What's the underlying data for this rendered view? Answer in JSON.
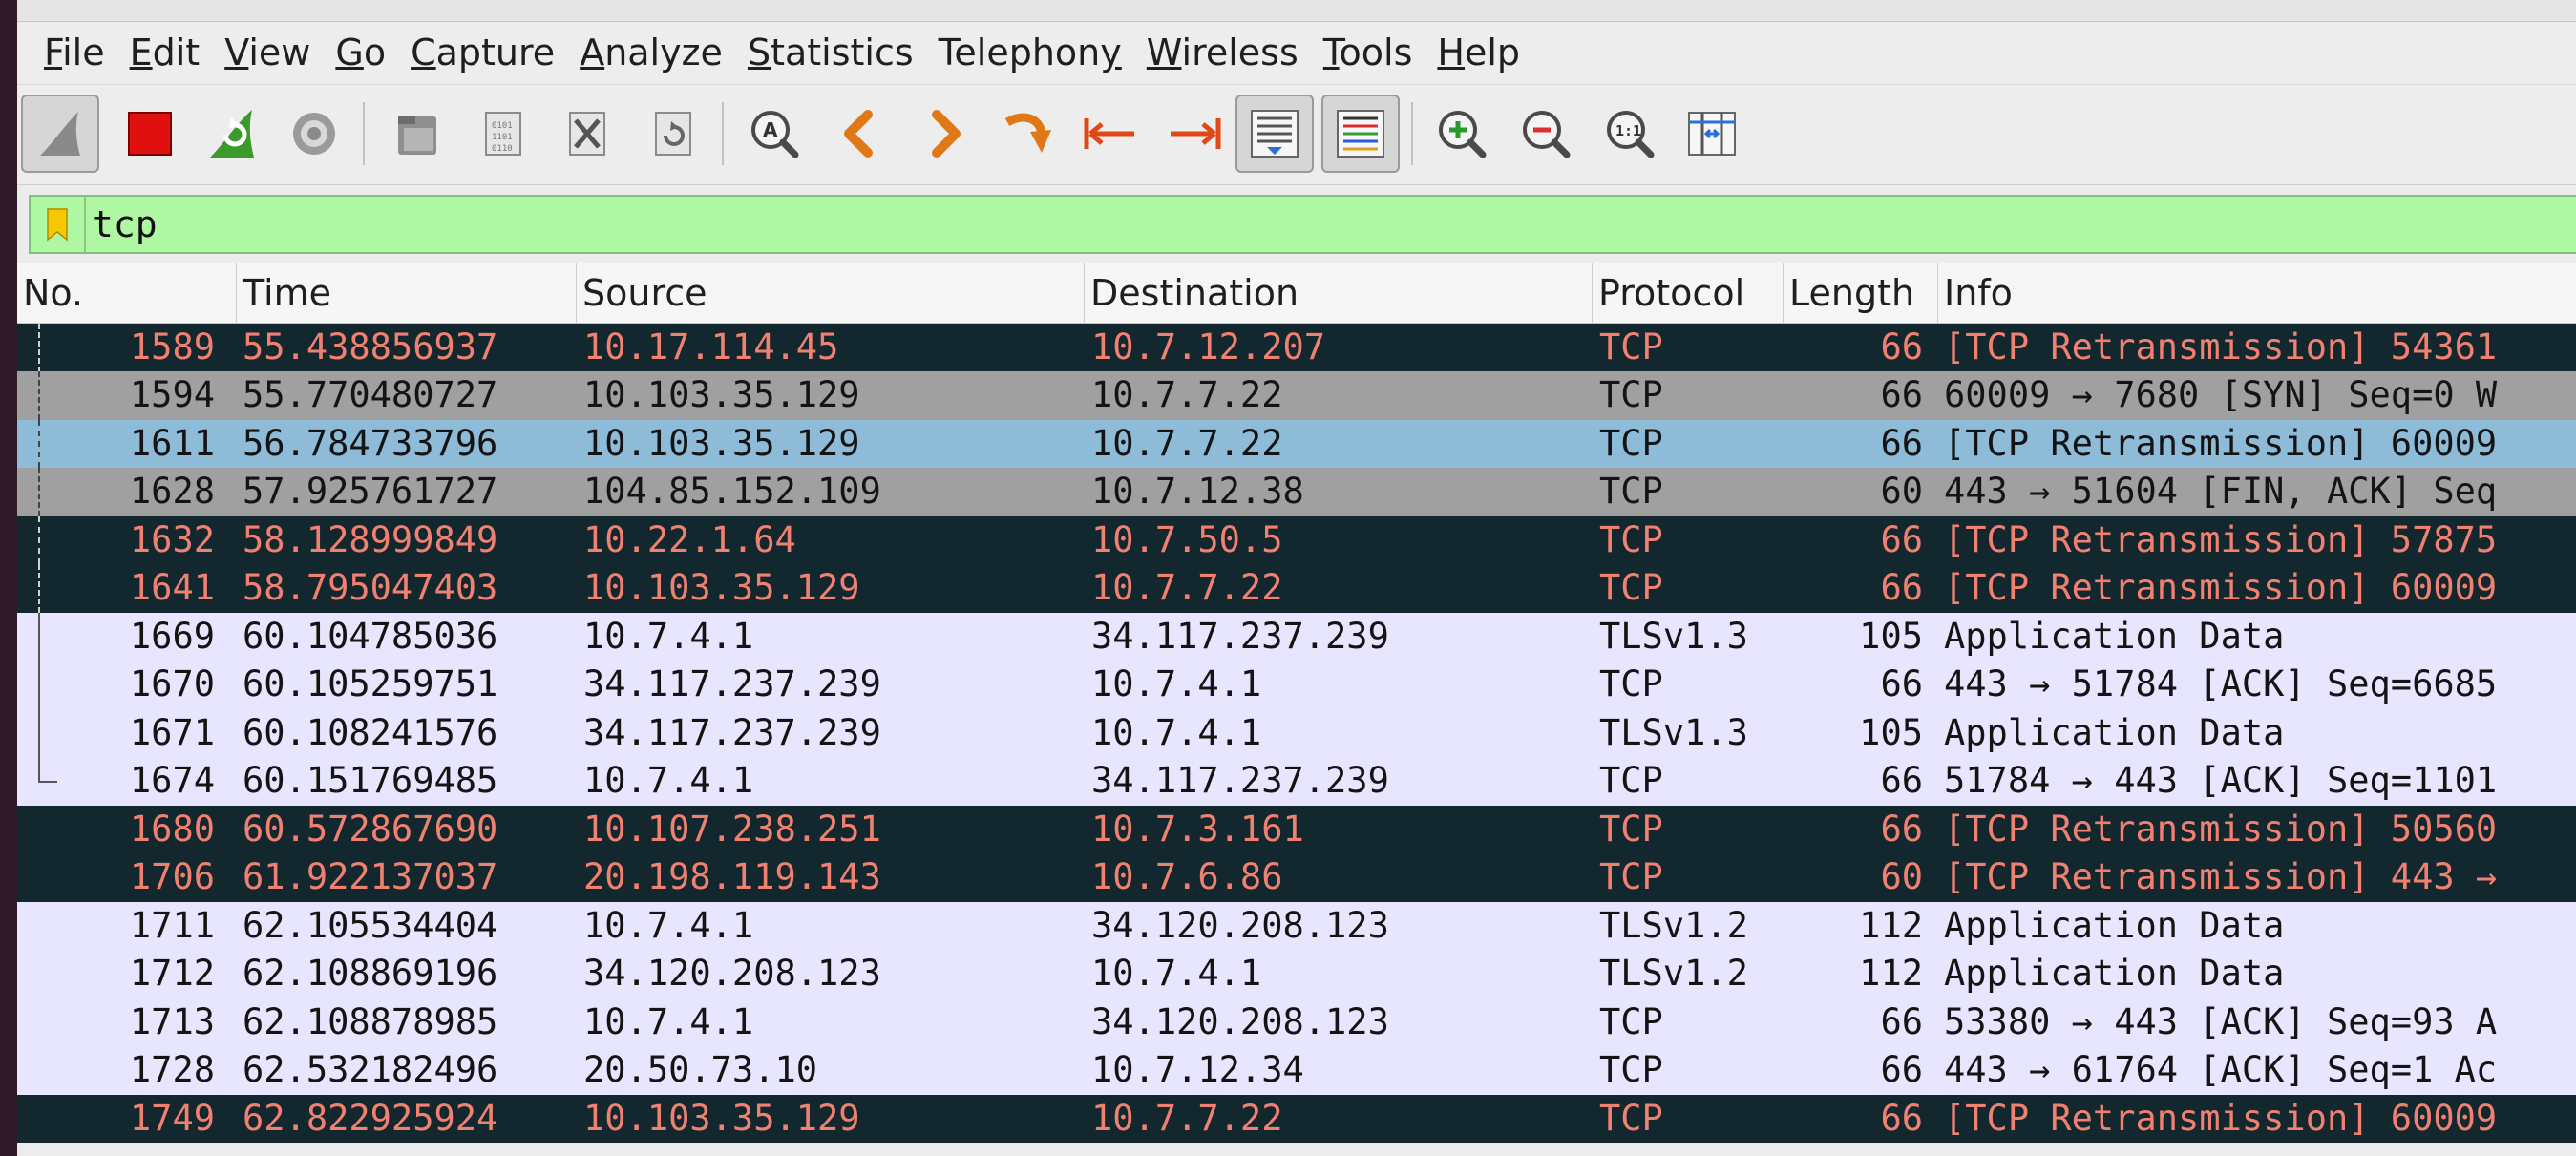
{
  "colors": {
    "row_bad_bg": "#12272e",
    "row_bad_fg": "#f08070",
    "row_gray_bg": "#a0a0a0",
    "row_gray_fg": "#141414",
    "row_selected_bg": "#8ebbd8",
    "row_selected_fg": "#141414",
    "row_normal_bg": "#e7e6fe",
    "row_normal_fg": "#141414",
    "filter_bg": "#aff7a3"
  },
  "menu": [
    {
      "pre": "",
      "mn": "F",
      "post": "ile"
    },
    {
      "pre": "",
      "mn": "E",
      "post": "dit"
    },
    {
      "pre": "",
      "mn": "V",
      "post": "iew"
    },
    {
      "pre": "",
      "mn": "G",
      "post": "o"
    },
    {
      "pre": "",
      "mn": "C",
      "post": "apture"
    },
    {
      "pre": "",
      "mn": "A",
      "post": "nalyze"
    },
    {
      "pre": "",
      "mn": "S",
      "post": "tatistics"
    },
    {
      "pre": "Telephon",
      "mn": "y",
      "post": ""
    },
    {
      "pre": "",
      "mn": "W",
      "post": "ireless"
    },
    {
      "pre": "",
      "mn": "T",
      "post": "ools"
    },
    {
      "pre": "",
      "mn": "H",
      "post": "elp"
    }
  ],
  "toolbar_icons": [
    "shark-fin-start-icon",
    "stop-capture-icon",
    "restart-capture-icon",
    "capture-options-gear-icon",
    "open-file-icon",
    "save-file-icon",
    "close-file-icon",
    "reload-file-icon",
    "find-packet-icon",
    "go-back-icon",
    "go-forward-icon",
    "go-to-packet-icon",
    "first-packet-icon",
    "last-packet-icon",
    "autoscroll-icon",
    "colorize-icon",
    "zoom-in-icon",
    "zoom-out-icon",
    "normal-size-icon",
    "resize-columns-icon"
  ],
  "filter": {
    "value": "tcp"
  },
  "columns": [
    "No.",
    "Time",
    "Source",
    "Destination",
    "Protocol",
    "Length",
    "Info"
  ],
  "packets": [
    {
      "no": "1589",
      "time": "55.438856937",
      "src": "10.17.114.45",
      "dst": "10.7.12.207",
      "proto": "TCP",
      "len": "66",
      "info": "[TCP Retransmission] 54361",
      "style": "bad"
    },
    {
      "no": "1594",
      "time": "55.770480727",
      "src": "10.103.35.129",
      "dst": "10.7.7.22",
      "proto": "TCP",
      "len": "66",
      "info": "60009 → 7680 [SYN] Seq=0 W",
      "style": "gray"
    },
    {
      "no": "1611",
      "time": "56.784733796",
      "src": "10.103.35.129",
      "dst": "10.7.7.22",
      "proto": "TCP",
      "len": "66",
      "info": "[TCP Retransmission] 60009",
      "style": "selected"
    },
    {
      "no": "1628",
      "time": "57.925761727",
      "src": "104.85.152.109",
      "dst": "10.7.12.38",
      "proto": "TCP",
      "len": "60",
      "info": "443 → 51604 [FIN, ACK] Seq",
      "style": "gray"
    },
    {
      "no": "1632",
      "time": "58.128999849",
      "src": "10.22.1.64",
      "dst": "10.7.50.5",
      "proto": "TCP",
      "len": "66",
      "info": "[TCP Retransmission] 57875",
      "style": "bad"
    },
    {
      "no": "1641",
      "time": "58.795047403",
      "src": "10.103.35.129",
      "dst": "10.7.7.22",
      "proto": "TCP",
      "len": "66",
      "info": "[TCP Retransmission] 60009",
      "style": "bad"
    },
    {
      "no": "1669",
      "time": "60.104785036",
      "src": "10.7.4.1",
      "dst": "34.117.237.239",
      "proto": "TLSv1.3",
      "len": "105",
      "info": "Application Data",
      "style": "normal"
    },
    {
      "no": "1670",
      "time": "60.105259751",
      "src": "34.117.237.239",
      "dst": "10.7.4.1",
      "proto": "TCP",
      "len": "66",
      "info": "443 → 51784 [ACK] Seq=6685",
      "style": "normal"
    },
    {
      "no": "1671",
      "time": "60.108241576",
      "src": "34.117.237.239",
      "dst": "10.7.4.1",
      "proto": "TLSv1.3",
      "len": "105",
      "info": "Application Data",
      "style": "normal"
    },
    {
      "no": "1674",
      "time": "60.151769485",
      "src": "10.7.4.1",
      "dst": "34.117.237.239",
      "proto": "TCP",
      "len": "66",
      "info": "51784 → 443 [ACK] Seq=1101",
      "style": "normal"
    },
    {
      "no": "1680",
      "time": "60.572867690",
      "src": "10.107.238.251",
      "dst": "10.7.3.161",
      "proto": "TCP",
      "len": "66",
      "info": "[TCP Retransmission] 50560",
      "style": "bad"
    },
    {
      "no": "1706",
      "time": "61.922137037",
      "src": "20.198.119.143",
      "dst": "10.7.6.86",
      "proto": "TCP",
      "len": "60",
      "info": "[TCP Retransmission] 443 →",
      "style": "bad"
    },
    {
      "no": "1711",
      "time": "62.105534404",
      "src": "10.7.4.1",
      "dst": "34.120.208.123",
      "proto": "TLSv1.2",
      "len": "112",
      "info": "Application Data",
      "style": "normal"
    },
    {
      "no": "1712",
      "time": "62.108869196",
      "src": "34.120.208.123",
      "dst": "10.7.4.1",
      "proto": "TLSv1.2",
      "len": "112",
      "info": "Application Data",
      "style": "normal"
    },
    {
      "no": "1713",
      "time": "62.108878985",
      "src": "10.7.4.1",
      "dst": "34.120.208.123",
      "proto": "TCP",
      "len": "66",
      "info": "53380 → 443 [ACK] Seq=93 A",
      "style": "normal"
    },
    {
      "no": "1728",
      "time": "62.532182496",
      "src": "20.50.73.10",
      "dst": "10.7.12.34",
      "proto": "TCP",
      "len": "66",
      "info": "443 → 61764 [ACK] Seq=1 Ac",
      "style": "normal"
    },
    {
      "no": "1749",
      "time": "62.822925924",
      "src": "10.103.35.129",
      "dst": "10.7.7.22",
      "proto": "TCP",
      "len": "66",
      "info": "[TCP Retransmission] 60009",
      "style": "bad"
    }
  ]
}
